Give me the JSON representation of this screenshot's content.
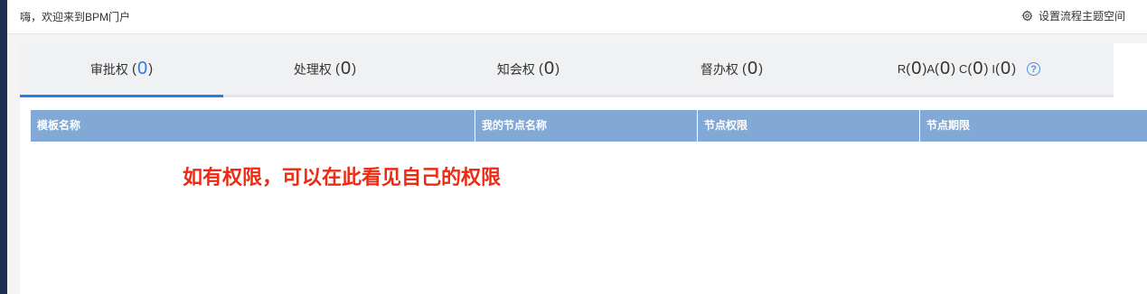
{
  "header": {
    "welcome": "嗨，欢迎来到BPM门户",
    "settings_label": "设置流程主题空间",
    "settings_icon": "gear-icon"
  },
  "tabs": [
    {
      "label": "审批权",
      "count": "0",
      "active": true
    },
    {
      "label": "处理权",
      "count": "0",
      "active": false
    },
    {
      "label": "知会权",
      "count": "0",
      "active": false
    },
    {
      "label": "督办权",
      "count": "0",
      "active": false
    }
  ],
  "raci": {
    "r_label": "R",
    "r_count": "0",
    "a_label": "A",
    "a_count": "0",
    "c_label": "C",
    "c_count": "0",
    "i_label": "I",
    "i_count": "0",
    "help_icon": "question-circle-icon"
  },
  "table": {
    "columns": [
      "模板名称",
      "我的节点名称",
      "节点权限",
      "节点期限"
    ]
  },
  "annotation": "如有权限，可以在此看见自己的权限",
  "colors": {
    "accent": "#2a7ee0",
    "table_header": "#82a9d6",
    "annotation": "#ee2a13",
    "sidebar": "#1f2f4f"
  }
}
